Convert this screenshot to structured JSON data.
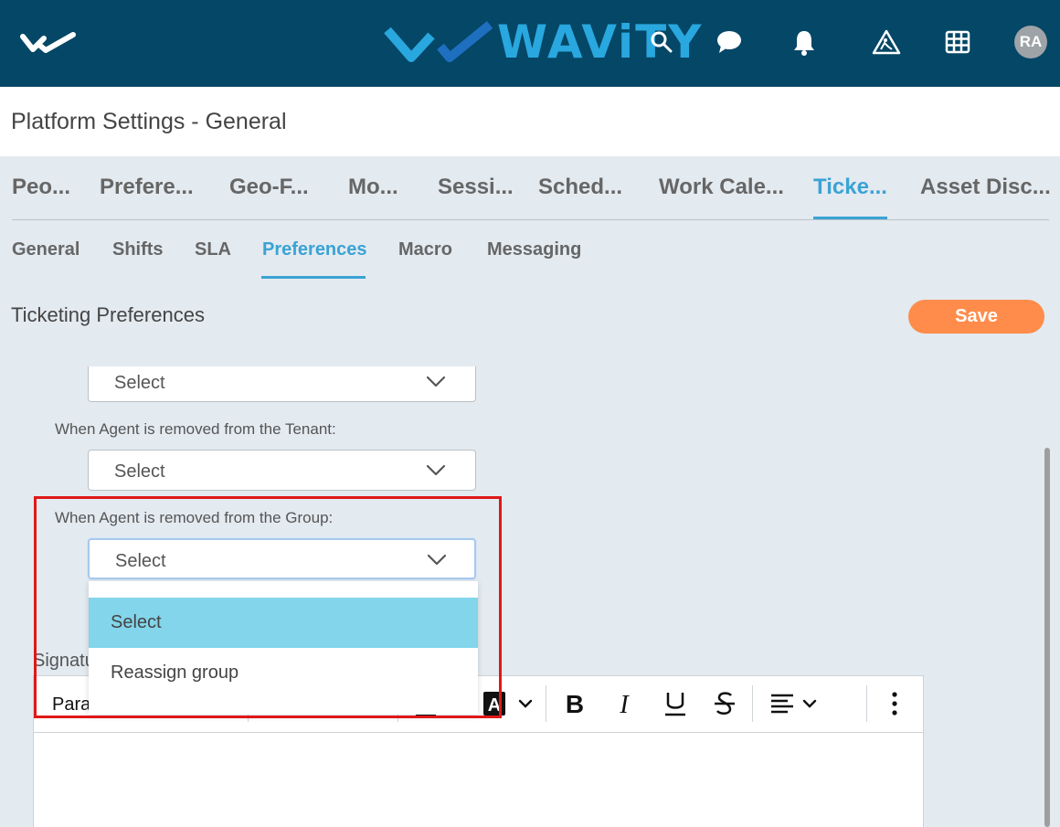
{
  "header": {
    "brand_name": "WAViTY",
    "user_initials": "RA",
    "colors": {
      "bar": "#044766",
      "brand": "#29a7df"
    }
  },
  "page": {
    "title": "Platform Settings - General"
  },
  "main_tabs": [
    {
      "label": "Peo..."
    },
    {
      "label": "Prefere..."
    },
    {
      "label": "Geo-F..."
    },
    {
      "label": "Mo..."
    },
    {
      "label": "Sessi..."
    },
    {
      "label": "Sched..."
    },
    {
      "label": "Work Cale..."
    },
    {
      "label": "Ticke..."
    },
    {
      "label": "Asset Disc..."
    }
  ],
  "sub_tabs": [
    {
      "label": "General"
    },
    {
      "label": "Shifts"
    },
    {
      "label": "SLA"
    },
    {
      "label": "Preferences"
    },
    {
      "label": "Macro"
    },
    {
      "label": "Messaging"
    }
  ],
  "section": {
    "title": "Ticketing Preferences",
    "save_label": "Save"
  },
  "fields": [
    {
      "label": "",
      "value": "Select"
    },
    {
      "label": "When Agent is removed from the Tenant:",
      "value": "Select"
    },
    {
      "label": "When Agent is removed from the Group:",
      "value": "Select"
    }
  ],
  "dropdown": {
    "options": [
      {
        "label": "Select"
      },
      {
        "label": "Reassign group"
      }
    ],
    "selected_index": 0
  },
  "signature": {
    "label": "Signatu",
    "paragraph_label": "Para"
  },
  "accent": {
    "tab_active": "#3aa3d4",
    "save": "#ff8c4a",
    "highlight": "#e01818",
    "option_selected": "#82d5eb"
  }
}
